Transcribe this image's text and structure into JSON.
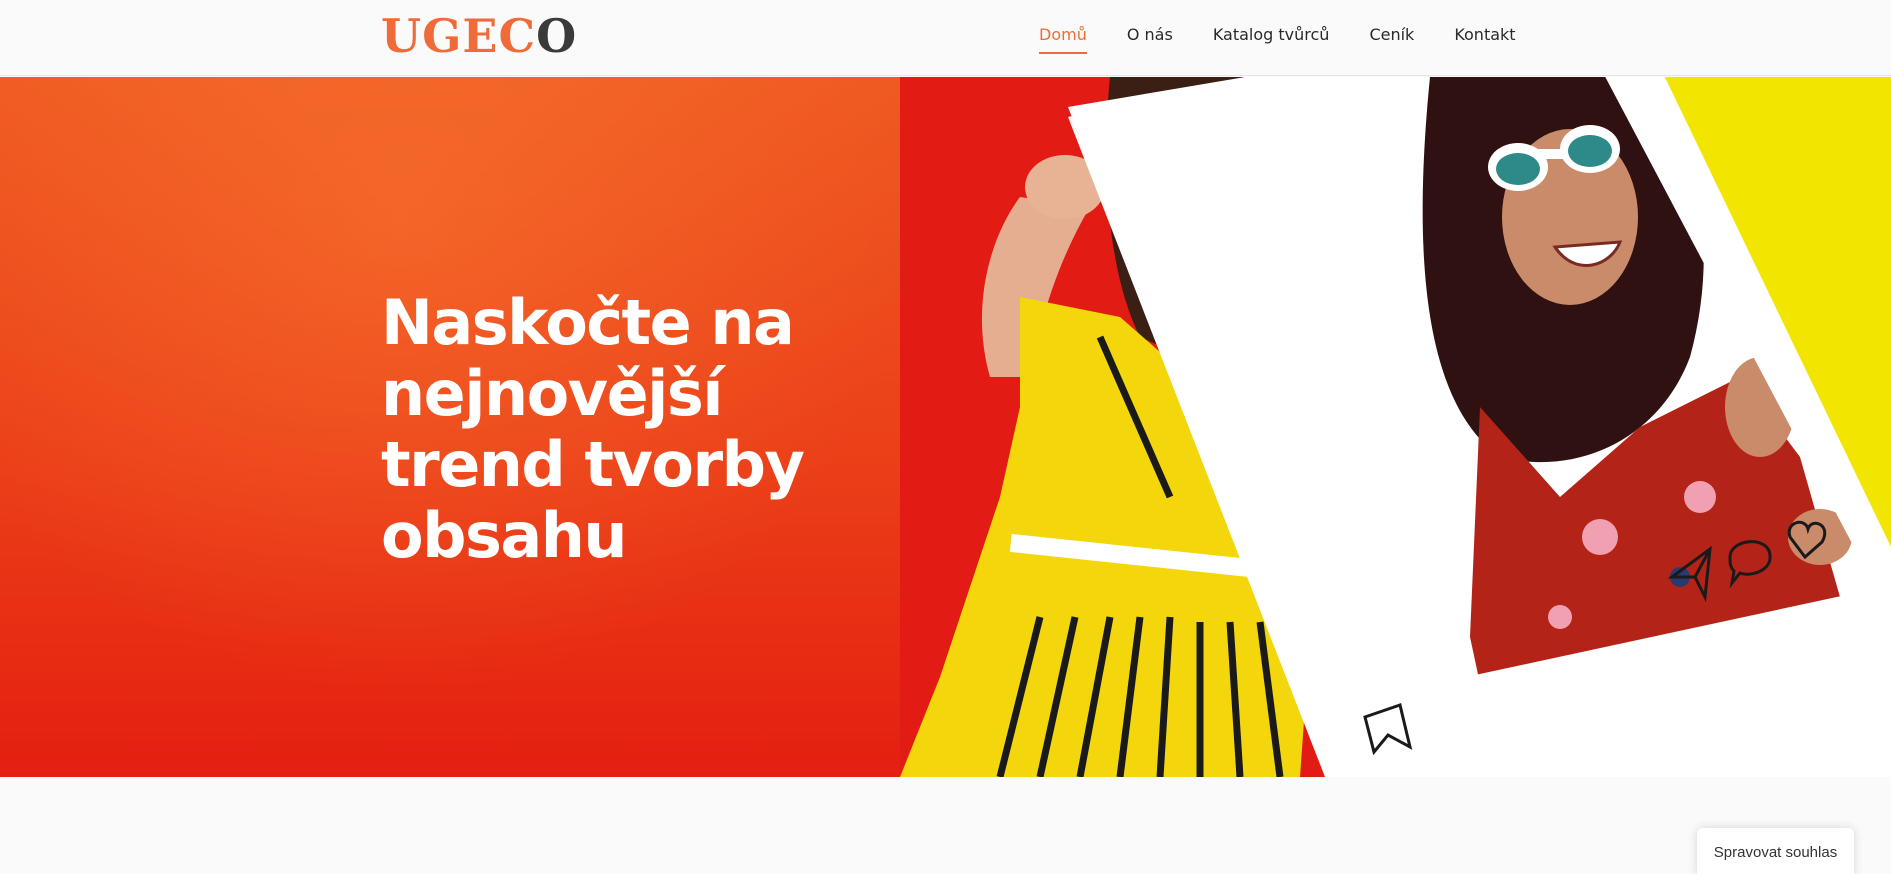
{
  "brand": {
    "letters": [
      {
        "char": "U",
        "color": "#ef6c3a"
      },
      {
        "char": "G",
        "color": "#ef6c3a"
      },
      {
        "char": "E",
        "color": "#ef6c3a"
      },
      {
        "char": "C",
        "color": "#ef6c3a"
      },
      {
        "char": "O",
        "color": "#3a3a3a"
      }
    ]
  },
  "nav": {
    "items": [
      {
        "label": "Domů",
        "active": true
      },
      {
        "label": "O nás",
        "active": false
      },
      {
        "label": "Katalog tvůrců",
        "active": false
      },
      {
        "label": "Ceník",
        "active": false
      },
      {
        "label": "Kontakt",
        "active": false
      }
    ]
  },
  "hero": {
    "title": "Naskočte na nejnovější trend tvorby obsahu"
  },
  "consent": {
    "label": "Spravovat souhlas"
  },
  "colors": {
    "accent": "#ef6c3a",
    "hero_red": "#e9341a",
    "hero_yellow": "#f2e400",
    "text_dark": "#2a2a2a"
  },
  "icons": {
    "frame_share": "paper-plane-icon",
    "frame_comment": "speech-bubble-icon",
    "frame_like": "heart-icon",
    "frame_save": "bookmark-icon"
  }
}
